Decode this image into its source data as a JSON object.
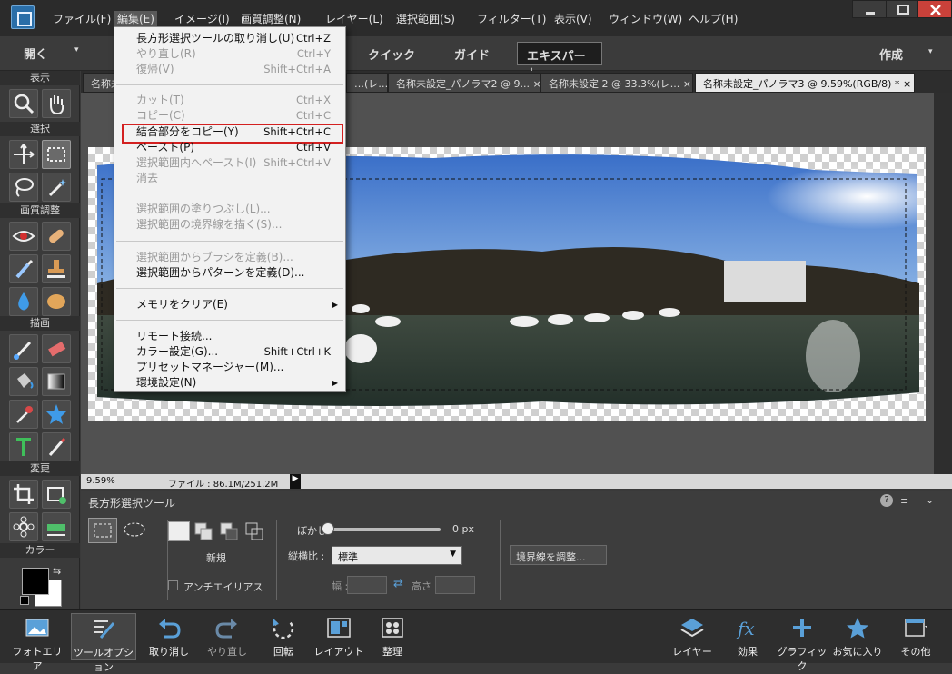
{
  "menubar": {
    "items": [
      "ファイル(F)",
      "編集(E)",
      "イメージ(I)",
      "画質調整(N)",
      "レイヤー(L)",
      "選択範囲(S)",
      "フィルター(T)",
      "表示(V)",
      "ウィンドウ(W)",
      "ヘルプ(H)"
    ],
    "active": "編集(E)"
  },
  "toolbar": {
    "open_label": "開く",
    "modes": [
      "クイック",
      "ガイド",
      "エキスパート"
    ],
    "selected_mode": "エキスパート",
    "create_label": "作成"
  },
  "panels": {
    "view": "表示",
    "select": "選択",
    "enhance": "画質調整",
    "draw": "描画",
    "modify": "変更",
    "color": "カラー"
  },
  "tabs": [
    {
      "label": "名称未"
    },
    {
      "label": "…(レ…",
      "close": "×"
    },
    {
      "label": "名称未設定_パノラマ2 @ 9...",
      "close": "×"
    },
    {
      "label": "名称未設定 2 @ 33.3%(レ...",
      "close": "×"
    },
    {
      "label": "名称未設定_パノラマ3 @ 9.59%(RGB/8) *",
      "close": "×",
      "active": true
    }
  ],
  "status": {
    "zoom": "9.59%",
    "file": "ファイル : 86.1M/251.2M"
  },
  "tool_options": {
    "title": "長方形選択ツール",
    "new_label": "新規",
    "antialias_label": "アンチエイリアス",
    "feather_label": "ぼかし :",
    "feather_value": "0 px",
    "feather_level": 0,
    "aspect_label": "縦横比 :",
    "aspect_value": "標準",
    "width_label": "幅 :",
    "height_label": "高さ :",
    "refine_label": "境界線を調整..."
  },
  "edit_menu": [
    {
      "label": "長方形選択ツールの取り消し(U)",
      "shortcut": "Ctrl+Z",
      "enabled": true
    },
    {
      "label": "やり直し(R)",
      "shortcut": "Ctrl+Y",
      "enabled": false
    },
    {
      "label": "復帰(V)",
      "shortcut": "Shift+Ctrl+A",
      "enabled": false
    },
    {
      "label": "カット(T)",
      "shortcut": "Ctrl+X",
      "enabled": false
    },
    {
      "label": "コピー(C)",
      "shortcut": "Ctrl+C",
      "enabled": false
    },
    {
      "label": "結合部分をコピー(Y)",
      "shortcut": "Shift+Ctrl+C",
      "enabled": true,
      "highlighted": true
    },
    {
      "label": "ペースト(P)",
      "shortcut": "Ctrl+V",
      "enabled": true
    },
    {
      "label": "選択範囲内へペースト(I)",
      "shortcut": "Shift+Ctrl+V",
      "enabled": false
    },
    {
      "label": "消去",
      "shortcut": "",
      "enabled": false
    },
    {
      "label": "選択範囲の塗りつぶし(L)...",
      "shortcut": "",
      "enabled": false
    },
    {
      "label": "選択範囲の境界線を描く(S)...",
      "shortcut": "",
      "enabled": false
    },
    {
      "label": "選択範囲からブラシを定義(B)...",
      "shortcut": "",
      "enabled": false
    },
    {
      "label": "選択範囲からパターンを定義(D)...",
      "shortcut": "",
      "enabled": true
    },
    {
      "label": "メモリをクリア(E)",
      "shortcut": "",
      "enabled": true,
      "submenu": true
    },
    {
      "label": "リモート接続...",
      "shortcut": "",
      "enabled": true
    },
    {
      "label": "カラー設定(G)...",
      "shortcut": "Shift+Ctrl+K",
      "enabled": true
    },
    {
      "label": "プリセットマネージャー(M)...",
      "shortcut": "",
      "enabled": true
    },
    {
      "label": "環境設定(N)",
      "shortcut": "",
      "enabled": true,
      "submenu": true
    }
  ],
  "bottom_bar": {
    "left": [
      "フォトエリア",
      "ツールオプション",
      "取り消し",
      "やり直し",
      "回転",
      "レイアウト",
      "整理"
    ],
    "right": [
      "レイヤー",
      "効果",
      "グラフィック",
      "お気に入り",
      "その他"
    ]
  },
  "colors": {
    "foreground": "#000000",
    "background": "#ffffff",
    "highlight_border": "#d32020"
  }
}
